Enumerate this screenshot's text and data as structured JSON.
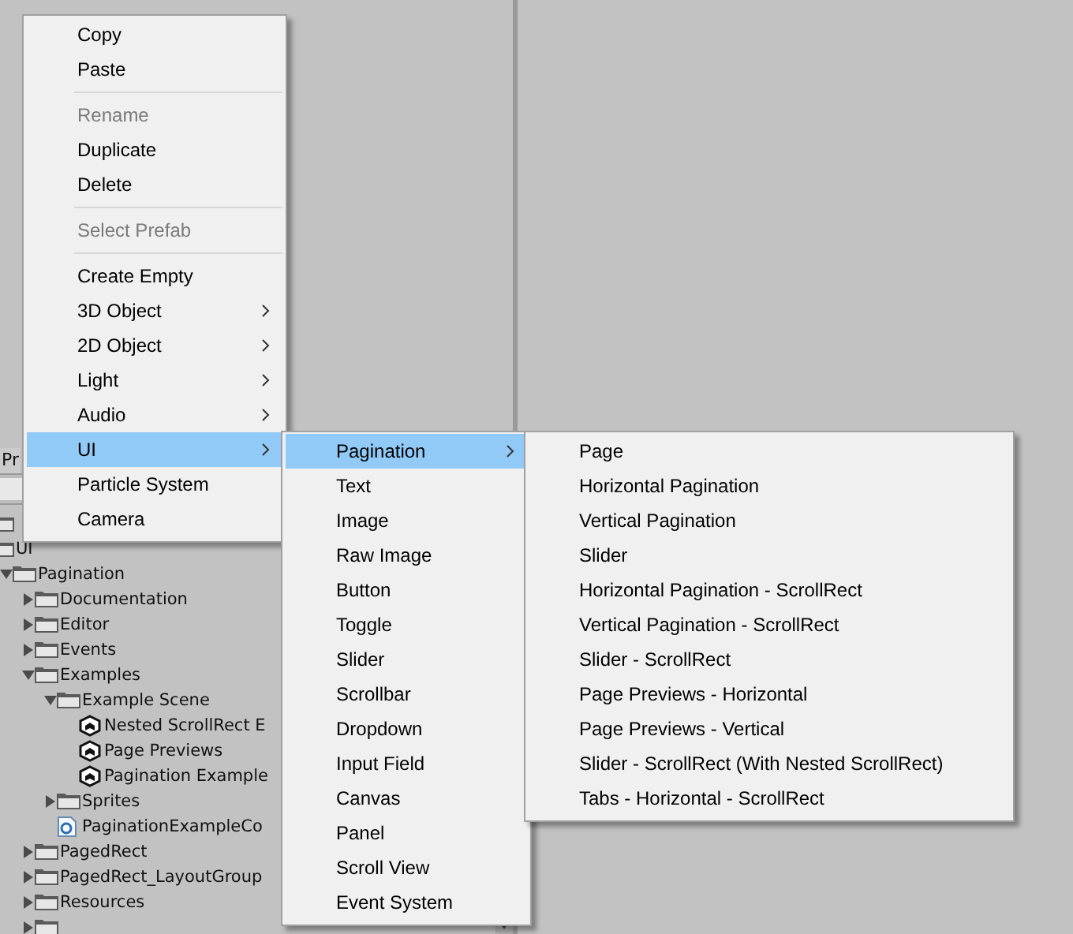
{
  "project_panel": {
    "tab": "Pr",
    "tree": [
      {
        "kind": "folder"
      },
      {
        "label": "UI",
        "kind": "folder",
        "children": [
          {
            "label": "Pagination",
            "kind": "folder",
            "expanded": true,
            "children": [
              {
                "label": "Documentation",
                "kind": "folder",
                "expanded": false
              },
              {
                "label": "Editor",
                "kind": "folder",
                "expanded": false
              },
              {
                "label": "Events",
                "kind": "folder",
                "expanded": false
              },
              {
                "label": "Examples",
                "kind": "folder",
                "expanded": true,
                "children": [
                  {
                    "label": "Example Scene",
                    "kind": "folder",
                    "expanded": true,
                    "children": [
                      {
                        "label": "Nested ScrollRect E",
                        "kind": "scene"
                      },
                      {
                        "label": "Page Previews",
                        "kind": "scene"
                      },
                      {
                        "label": "Pagination Example",
                        "kind": "scene"
                      }
                    ]
                  },
                  {
                    "label": "Sprites",
                    "kind": "folder",
                    "expanded": false
                  },
                  {
                    "label": "PaginationExampleCo",
                    "kind": "script"
                  }
                ]
              },
              {
                "label": "PagedRect",
                "kind": "folder",
                "expanded": false
              },
              {
                "label": "PagedRect_LayoutGroup",
                "kind": "folder",
                "expanded": false
              },
              {
                "label": "Resources",
                "kind": "folder",
                "expanded": false
              },
              {
                "kind": "folder",
                "expanded": false
              }
            ]
          }
        ]
      }
    ]
  },
  "context_menu": [
    {
      "kind": "item",
      "label": "Copy",
      "disabled": false,
      "selected": false,
      "submenu": false
    },
    {
      "kind": "item",
      "label": "Paste",
      "disabled": false,
      "selected": false,
      "submenu": false
    },
    {
      "kind": "separator"
    },
    {
      "kind": "item",
      "label": "Rename",
      "disabled": true,
      "selected": false,
      "submenu": false
    },
    {
      "kind": "item",
      "label": "Duplicate",
      "disabled": false,
      "selected": false,
      "submenu": false
    },
    {
      "kind": "item",
      "label": "Delete",
      "disabled": false,
      "selected": false,
      "submenu": false
    },
    {
      "kind": "separator"
    },
    {
      "kind": "item",
      "label": "Select Prefab",
      "disabled": true,
      "selected": false,
      "submenu": false
    },
    {
      "kind": "separator"
    },
    {
      "kind": "item",
      "label": "Create Empty",
      "disabled": false,
      "selected": false,
      "submenu": false
    },
    {
      "kind": "item",
      "label": "3D Object",
      "disabled": false,
      "selected": false,
      "submenu": true
    },
    {
      "kind": "item",
      "label": "2D Object",
      "disabled": false,
      "selected": false,
      "submenu": true
    },
    {
      "kind": "item",
      "label": "Light",
      "disabled": false,
      "selected": false,
      "submenu": true
    },
    {
      "kind": "item",
      "label": "Audio",
      "disabled": false,
      "selected": false,
      "submenu": true
    },
    {
      "kind": "item",
      "label": "UI",
      "disabled": false,
      "selected": true,
      "submenu": true
    },
    {
      "kind": "item",
      "label": "Particle System",
      "disabled": false,
      "selected": false,
      "submenu": false
    },
    {
      "kind": "item",
      "label": "Camera",
      "disabled": false,
      "selected": false,
      "submenu": false
    }
  ],
  "ui_submenu": [
    {
      "kind": "item",
      "label": "Pagination",
      "disabled": false,
      "selected": true,
      "submenu": true
    },
    {
      "kind": "item",
      "label": "Text",
      "disabled": false,
      "selected": false,
      "submenu": false
    },
    {
      "kind": "item",
      "label": "Image",
      "disabled": false,
      "selected": false,
      "submenu": false
    },
    {
      "kind": "item",
      "label": "Raw Image",
      "disabled": false,
      "selected": false,
      "submenu": false
    },
    {
      "kind": "item",
      "label": "Button",
      "disabled": false,
      "selected": false,
      "submenu": false
    },
    {
      "kind": "item",
      "label": "Toggle",
      "disabled": false,
      "selected": false,
      "submenu": false
    },
    {
      "kind": "item",
      "label": "Slider",
      "disabled": false,
      "selected": false,
      "submenu": false
    },
    {
      "kind": "item",
      "label": "Scrollbar",
      "disabled": false,
      "selected": false,
      "submenu": false
    },
    {
      "kind": "item",
      "label": "Dropdown",
      "disabled": false,
      "selected": false,
      "submenu": false
    },
    {
      "kind": "item",
      "label": "Input Field",
      "disabled": false,
      "selected": false,
      "submenu": false
    },
    {
      "kind": "item",
      "label": "Canvas",
      "disabled": false,
      "selected": false,
      "submenu": false
    },
    {
      "kind": "item",
      "label": "Panel",
      "disabled": false,
      "selected": false,
      "submenu": false
    },
    {
      "kind": "item",
      "label": "Scroll View",
      "disabled": false,
      "selected": false,
      "submenu": false
    },
    {
      "kind": "item",
      "label": "Event System",
      "disabled": false,
      "selected": false,
      "submenu": false
    }
  ],
  "pagination_submenu": [
    {
      "kind": "item",
      "label": "Page",
      "disabled": false,
      "selected": false,
      "submenu": false
    },
    {
      "kind": "item",
      "label": "Horizontal Pagination",
      "disabled": false,
      "selected": false,
      "submenu": false
    },
    {
      "kind": "item",
      "label": "Vertical Pagination",
      "disabled": false,
      "selected": false,
      "submenu": false
    },
    {
      "kind": "item",
      "label": "Slider",
      "disabled": false,
      "selected": false,
      "submenu": false
    },
    {
      "kind": "item",
      "label": "Horizontal Pagination - ScrollRect",
      "disabled": false,
      "selected": false,
      "submenu": false
    },
    {
      "kind": "item",
      "label": "Vertical Pagination - ScrollRect",
      "disabled": false,
      "selected": false,
      "submenu": false
    },
    {
      "kind": "item",
      "label": "Slider - ScrollRect",
      "disabled": false,
      "selected": false,
      "submenu": false
    },
    {
      "kind": "item",
      "label": "Page Previews - Horizontal",
      "disabled": false,
      "selected": false,
      "submenu": false
    },
    {
      "kind": "item",
      "label": "Page Previews - Vertical",
      "disabled": false,
      "selected": false,
      "submenu": false
    },
    {
      "kind": "item",
      "label": "Slider - ScrollRect (With Nested ScrollRect)",
      "disabled": false,
      "selected": false,
      "submenu": false
    },
    {
      "kind": "item",
      "label": "Tabs - Horizontal - ScrollRect",
      "disabled": false,
      "selected": false,
      "submenu": false
    }
  ]
}
